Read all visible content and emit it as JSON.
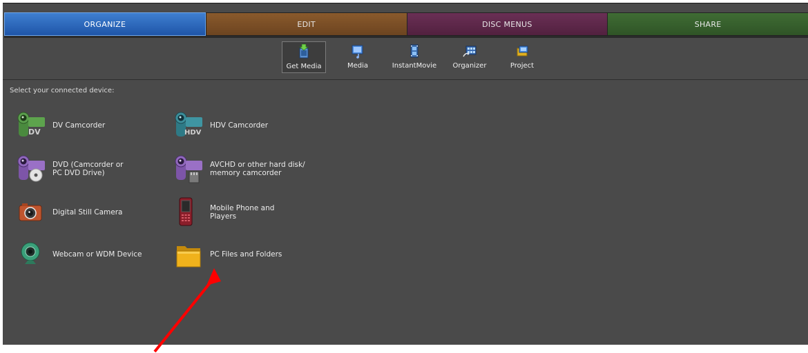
{
  "tabs": [
    {
      "label": "ORGANIZE"
    },
    {
      "label": "EDIT"
    },
    {
      "label": "DISC MENUS"
    },
    {
      "label": "SHARE"
    }
  ],
  "toolbar": {
    "items": [
      {
        "label": "Get Media",
        "icon": "get-media-icon"
      },
      {
        "label": "Media",
        "icon": "media-icon"
      },
      {
        "label": "InstantMovie",
        "icon": "instant-movie-icon"
      },
      {
        "label": "Organizer",
        "icon": "organizer-icon"
      },
      {
        "label": "Project",
        "icon": "project-icon"
      }
    ]
  },
  "prompt": "Select your connected device:",
  "devices": [
    {
      "label": "DV Camcorder",
      "icon": "dv-camcorder-icon"
    },
    {
      "label": "HDV Camcorder",
      "icon": "hdv-camcorder-icon"
    },
    {
      "label": "DVD (Camcorder or\nPC DVD Drive)",
      "icon": "dvd-camcorder-icon"
    },
    {
      "label": "AVCHD or other hard disk/\nmemory camcorder",
      "icon": "avchd-camcorder-icon"
    },
    {
      "label": "Digital Still Camera",
      "icon": "digital-camera-icon"
    },
    {
      "label": "Mobile Phone and\nPlayers",
      "icon": "mobile-phone-icon"
    },
    {
      "label": "Webcam or WDM Device",
      "icon": "webcam-icon"
    },
    {
      "label": "PC Files and Folders",
      "icon": "folder-icon"
    }
  ],
  "colors": {
    "organize": "#2a64b8",
    "edit": "#7a4e26",
    "disc_menus": "#5e2849",
    "share": "#376030",
    "panel": "#4a4a4a",
    "annotation_arrow": "#ff0000"
  }
}
